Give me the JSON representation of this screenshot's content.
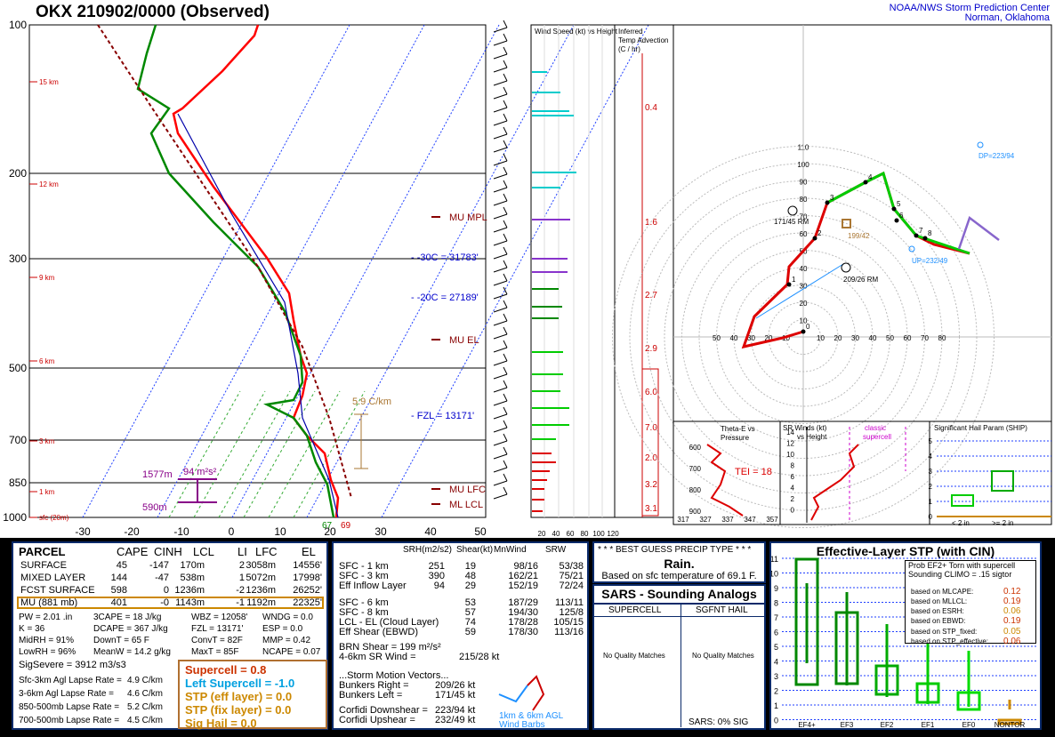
{
  "header": {
    "title": "OKX   210902/0000  (Observed)",
    "credit_line1": "NOAA/NWS Storm Prediction Center",
    "credit_line2": "Norman, Oklahoma"
  },
  "chart_data": [
    {
      "type": "line",
      "name": "skew-t",
      "pressure_ticks": [
        "100",
        "200",
        "300",
        "500",
        "700",
        "850",
        "1000"
      ],
      "temperature_ticks": [
        "-30",
        "-20",
        "-10",
        "0",
        "10",
        "20",
        "30",
        "40",
        "50"
      ],
      "height_labels": [
        "15 km",
        "12 km",
        "9 km",
        "6 km",
        "3 km",
        "1 km",
        "sfc (20m)"
      ],
      "level_labels": [
        "MU MPL",
        "MU EL",
        "MU LFC",
        "ML LCL"
      ],
      "isotherm_labels": [
        "-30C = 31783'",
        "-20C = 27189'",
        "FZL = 13171'"
      ],
      "lapse_label": "5.9 C/km",
      "layer_labels": {
        "top": "1577m",
        "bottom": "590m",
        "value": "94 m²s²"
      },
      "sfc_temps": [
        "67",
        "69"
      ],
      "colors": {
        "temperature": "#ff0000",
        "dewpoint": "#008800",
        "virtual": "#cc0000",
        "wetbulb": "#0000cc",
        "isotherm": "#0000cc",
        "height": "#cc0000"
      }
    },
    {
      "type": "line",
      "name": "hodograph",
      "ring_labels": [
        "10",
        "20",
        "30",
        "40",
        "50",
        "60",
        "70",
        "80",
        "90",
        "100",
        "110"
      ],
      "axis_labels_x": [
        "50",
        "40",
        "30",
        "20",
        "10",
        "10",
        "20",
        "30",
        "40",
        "50",
        "60",
        "70",
        "80"
      ],
      "point_labels": [
        "0",
        "1",
        "2",
        "3",
        "4",
        "5",
        "6",
        "7",
        "8"
      ],
      "annotations": {
        "left_mover": "171/45 RM",
        "right_mover": "209/26 RM",
        "mean": "199/42",
        "downshear": "DP=223/94",
        "upshear": "UP=232/49"
      }
    },
    {
      "type": "bar",
      "name": "wind speed vs height",
      "title": "Wind Speed (kt) vs Height",
      "x_ticks": [
        "20",
        "40",
        "60",
        "80",
        "100",
        "120"
      ]
    },
    {
      "type": "bar",
      "name": "inferred temp advection",
      "title": "Inferred Temp Advection (C / hr)",
      "labels": [
        "0.4",
        "1.6",
        "2.7",
        "2.9",
        "6.0",
        "7.0",
        "2.0",
        "3.2",
        "3.1"
      ]
    },
    {
      "type": "line",
      "name": "theta-e vs pressure",
      "title": "Theta-E vs Pressure",
      "y_ticks": [
        "600",
        "700",
        "800",
        "900"
      ],
      "x_ticks": [
        "317",
        "327",
        "337",
        "347",
        "357"
      ],
      "annotation": "TEI = 18"
    },
    {
      "type": "line",
      "name": "sr winds",
      "title": "SR Winds (kt) vs Height",
      "y_ticks": [
        "14",
        "12",
        "10",
        "8",
        "6",
        "4",
        "2",
        "0"
      ],
      "annotation": "classic supercell"
    },
    {
      "type": "bar",
      "name": "ship",
      "title": "Significant Hail Param (SHIP)",
      "y_ticks": [
        "5",
        "4",
        "3",
        "2",
        "1",
        "0"
      ],
      "categories": [
        "< 2 in",
        ">= 2 in"
      ]
    }
  ],
  "parcel": {
    "headers": [
      "PARCEL",
      "CAPE",
      "CINH",
      "LCL",
      "LI",
      "LFC",
      "EL"
    ],
    "rows": [
      [
        "SURFACE",
        "45",
        "-147",
        "170m",
        "2",
        "3058m",
        "14556'"
      ],
      [
        "MIXED LAYER",
        "144",
        "-47",
        "538m",
        "1",
        "5072m",
        "17998'"
      ],
      [
        "FCST SURFACE",
        "598",
        "0",
        "1236m",
        "-2",
        "1236m",
        "26252'"
      ],
      [
        "MU  (881 mb)",
        "401",
        "-0",
        "1143m",
        "-1",
        "1192m",
        "22325'"
      ]
    ],
    "indices": [
      [
        "PW = 2.01 .in",
        "3CAPE = 18 J/kg",
        "WBZ = 12058'",
        "WNDG = 0.0"
      ],
      [
        "K = 36",
        "DCAPE = 367 J/kg",
        "FZL = 13171'",
        "ESP = 0.0"
      ],
      [
        "MidRH = 91%",
        "DownT = 65 F",
        "ConvT = 82F",
        "MMP = 0.42"
      ],
      [
        "LowRH = 96%",
        "MeanW = 14.2 g/kg",
        "MaxT = 85F",
        "NCAPE = 0.07"
      ]
    ],
    "sig_severe": "SigSevere = 3912 m3/s3",
    "lapse": [
      [
        "Sfc-3km Agl Lapse Rate =",
        "4.9 C/km"
      ],
      [
        "3-6km Agl Lapse Rate =",
        "4.6 C/km"
      ],
      [
        "850-500mb Lapse Rate =",
        "5.2 C/km"
      ],
      [
        "700-500mb Lapse Rate =",
        "4.5 C/km"
      ]
    ],
    "composites": [
      "Supercell = 0.8",
      "Left Supercell = -1.0",
      "STP (eff layer) = 0.0",
      "STP (fix layer) = 0.0",
      "Sig Hail = 0.0"
    ]
  },
  "kinematics": {
    "headers": [
      "SRH(m2/s2)",
      "Shear(kt)",
      "MnWind",
      "SRW"
    ],
    "rows": [
      [
        "SFC - 1 km",
        "251",
        "19",
        "98/16",
        "53/38"
      ],
      [
        "SFC - 3 km",
        "390",
        "48",
        "162/21",
        "75/21"
      ],
      [
        "Eff Inflow Layer",
        "94",
        "29",
        "152/19",
        "72/24"
      ],
      [
        "SFC - 6 km",
        "",
        "53",
        "187/29",
        "113/11"
      ],
      [
        "SFC - 8 km",
        "",
        "57",
        "194/30",
        "125/8"
      ],
      [
        "LCL - EL (Cloud Layer)",
        "",
        "74",
        "178/28",
        "105/15"
      ],
      [
        "Eff Shear (EBWD)",
        "",
        "59",
        "178/30",
        "113/16"
      ]
    ],
    "brn_shear": "BRN Shear =  199 m²/s²",
    "sr_wind": "4-6km SR Wind =",
    "sr_wind_val": "215/28 kt",
    "storm_motion_title": "...Storm Motion Vectors...",
    "bunkers": [
      [
        "Bunkers Right =",
        "209/26 kt"
      ],
      [
        "Bunkers Left =",
        "171/45 kt"
      ]
    ],
    "corfidi": [
      [
        "Corfidi Downshear =",
        "223/94 kt"
      ],
      [
        "Corfidi Upshear =",
        "232/49 kt"
      ]
    ],
    "barb_caption1": "1km & 6km AGL",
    "barb_caption2": "Wind Barbs"
  },
  "precip": {
    "title": "* * * BEST GUESS PRECIP TYPE * * *",
    "type": "Rain.",
    "note": "Based on sfc temperature of 69.1 F."
  },
  "sars": {
    "title": "SARS - Sounding Analogs",
    "col1": "SUPERCELL",
    "col2": "SGFNT HAIL",
    "col1_text": "No Quality Matches",
    "col2_text": "No Quality Matches",
    "footer": "SARS:  0% SIG"
  },
  "stp": {
    "title": "Effective-Layer STP (with CIN)",
    "y_ticks": [
      "11",
      "10",
      "9",
      "8",
      "7",
      "6",
      "5",
      "4",
      "3",
      "2",
      "1",
      "0"
    ],
    "categories": [
      "EF4+",
      "EF3",
      "EF2",
      "EF1",
      "EF0",
      "NONTOR"
    ],
    "prob_title1": "Prob EF2+ Torn with supercell",
    "prob_title2": "Sounding CLIMO = .15 sigtor",
    "probs": [
      [
        "based on MLCAPE:",
        "0.12"
      ],
      [
        "based on MLLCL:",
        "0.19"
      ],
      [
        "based on ESRH:",
        "0.06"
      ],
      [
        "based on EBWD:",
        "0.19"
      ],
      [
        "based on STP_fixed:",
        "0.05"
      ],
      [
        "based on STP_effective:",
        "0.06"
      ]
    ]
  }
}
